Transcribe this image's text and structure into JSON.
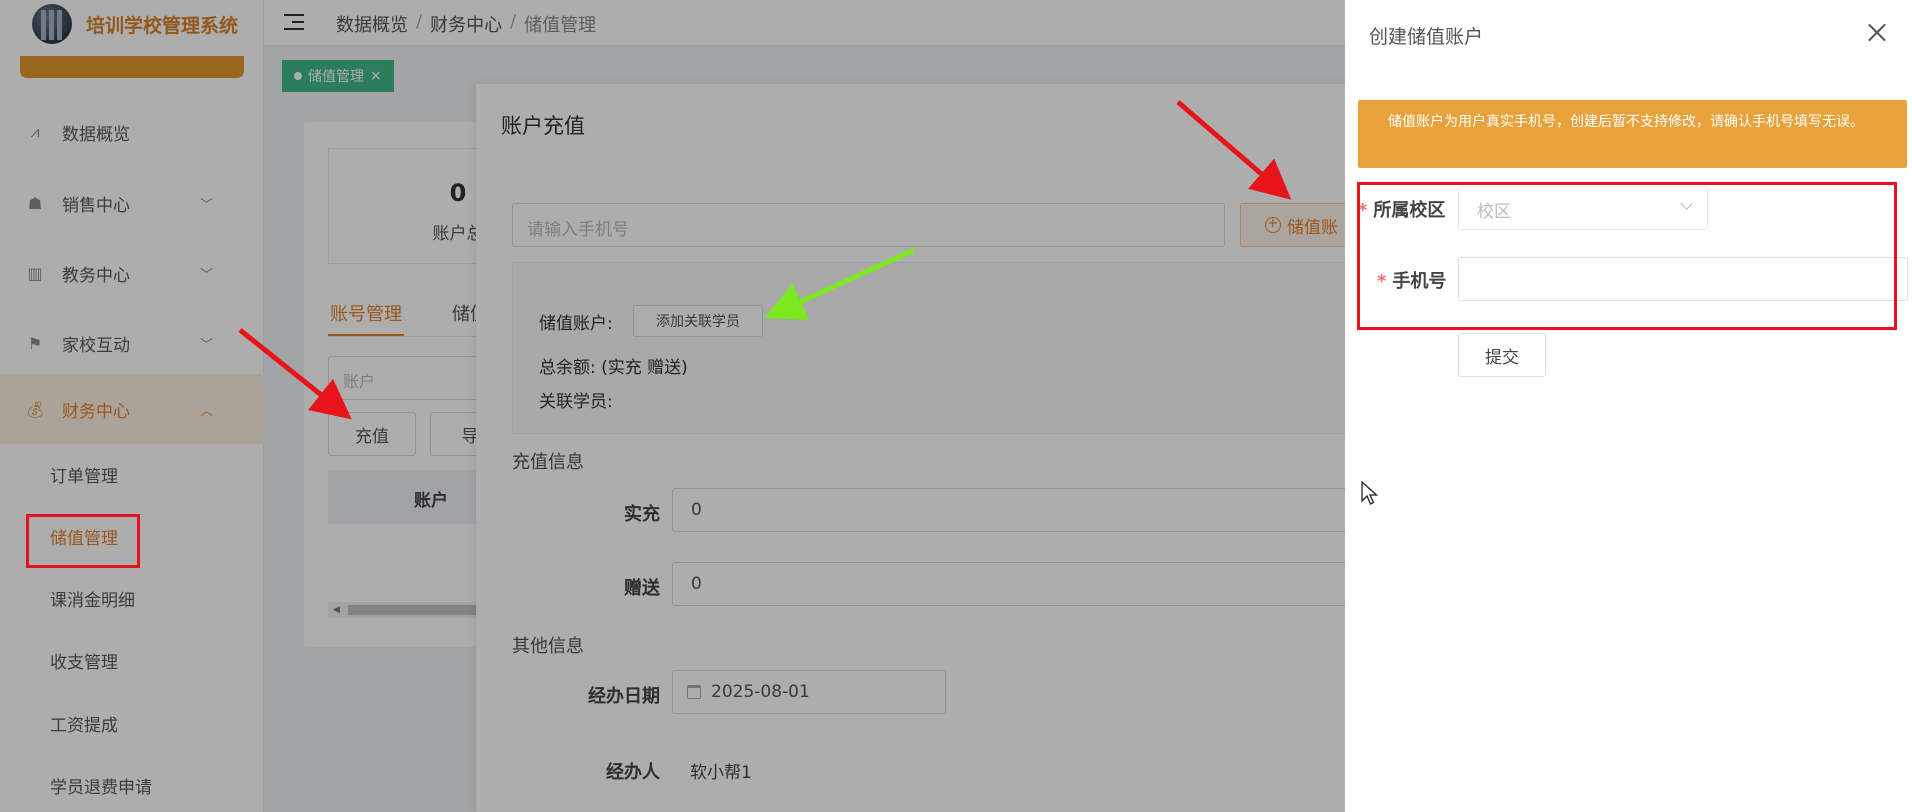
{
  "app": {
    "title": "培训学校管理系统"
  },
  "sidebar": {
    "menu": [
      {
        "label": "数据概览",
        "icon": "chart-icon",
        "has_arrow": false
      },
      {
        "label": "销售中心",
        "icon": "sales-icon",
        "has_arrow": true
      },
      {
        "label": "教务中心",
        "icon": "book-icon",
        "has_arrow": true
      },
      {
        "label": "家校互动",
        "icon": "flag-icon",
        "has_arrow": true
      },
      {
        "label": "财务中心",
        "icon": "money-bag-icon",
        "has_arrow": true,
        "active": true
      }
    ],
    "arrow_down": "﹀",
    "arrow_up": "︿",
    "submenu": [
      {
        "label": "订单管理"
      },
      {
        "label": "储值管理",
        "active": true
      },
      {
        "label": "课消金明细"
      },
      {
        "label": "收支管理"
      },
      {
        "label": "工资提成"
      },
      {
        "label": "学员退费申请"
      }
    ]
  },
  "header": {
    "breadcrumb": [
      "数据概览",
      "财务中心",
      "储值管理"
    ],
    "separator": "/"
  },
  "tags": [
    {
      "label": "储值管理",
      "close": "×"
    }
  ],
  "page": {
    "stat_value": "0",
    "stat_label": "账户总",
    "tabs": [
      "账号管理",
      "储值"
    ],
    "account_placeholder": "账户",
    "buttons": [
      "充值",
      "导"
    ],
    "table_header": "账户"
  },
  "dialog": {
    "title": "账户充值",
    "phone_placeholder": "请输入手机号",
    "account_button": "储值账",
    "account_label": "储值账户:",
    "add_student_button": "添加关联学员",
    "balance_label": "总余额:",
    "balance_detail": "(实充 赠送)",
    "students_label": "关联学员:",
    "recharge_section": "充值信息",
    "actual_label": "实充",
    "actual_value": "0",
    "bonus_label": "赠送",
    "bonus_value": "0",
    "other_section": "其他信息",
    "date_label": "经办日期",
    "date_value": "2025-08-01",
    "handler_label": "经办人",
    "handler_value": "软小帮1"
  },
  "drawer": {
    "title": "创建储值账户",
    "warning": "储值账户为用户真实手机号，创建后暂不支持修改，请确认手机号填写无误。",
    "campus_label": "所属校区",
    "campus_placeholder": "校区",
    "phone_label": "手机号",
    "phone_value": "",
    "submit": "提交",
    "required_mark": "*"
  },
  "colors": {
    "accent": "#e6812b",
    "warning_bg": "#e9a23b",
    "tag_green": "#42b983",
    "annotation_red": "#e8141b",
    "annotation_green": "#7ce81e"
  }
}
